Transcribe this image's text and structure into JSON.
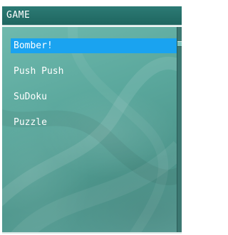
{
  "window": {
    "title": "GAME"
  },
  "menu": {
    "items": [
      {
        "label": "Bomber!",
        "selected": true
      },
      {
        "label": "Push Push",
        "selected": false
      },
      {
        "label": "SuDoku",
        "selected": false
      },
      {
        "label": "Puzzle",
        "selected": false
      }
    ]
  },
  "colors": {
    "title_bar": "#237069",
    "background": "#5aa79c",
    "selection": "#1aa3f0",
    "text": "#ffffff"
  },
  "icons": {
    "scrollbar": "scroll-thumb"
  }
}
